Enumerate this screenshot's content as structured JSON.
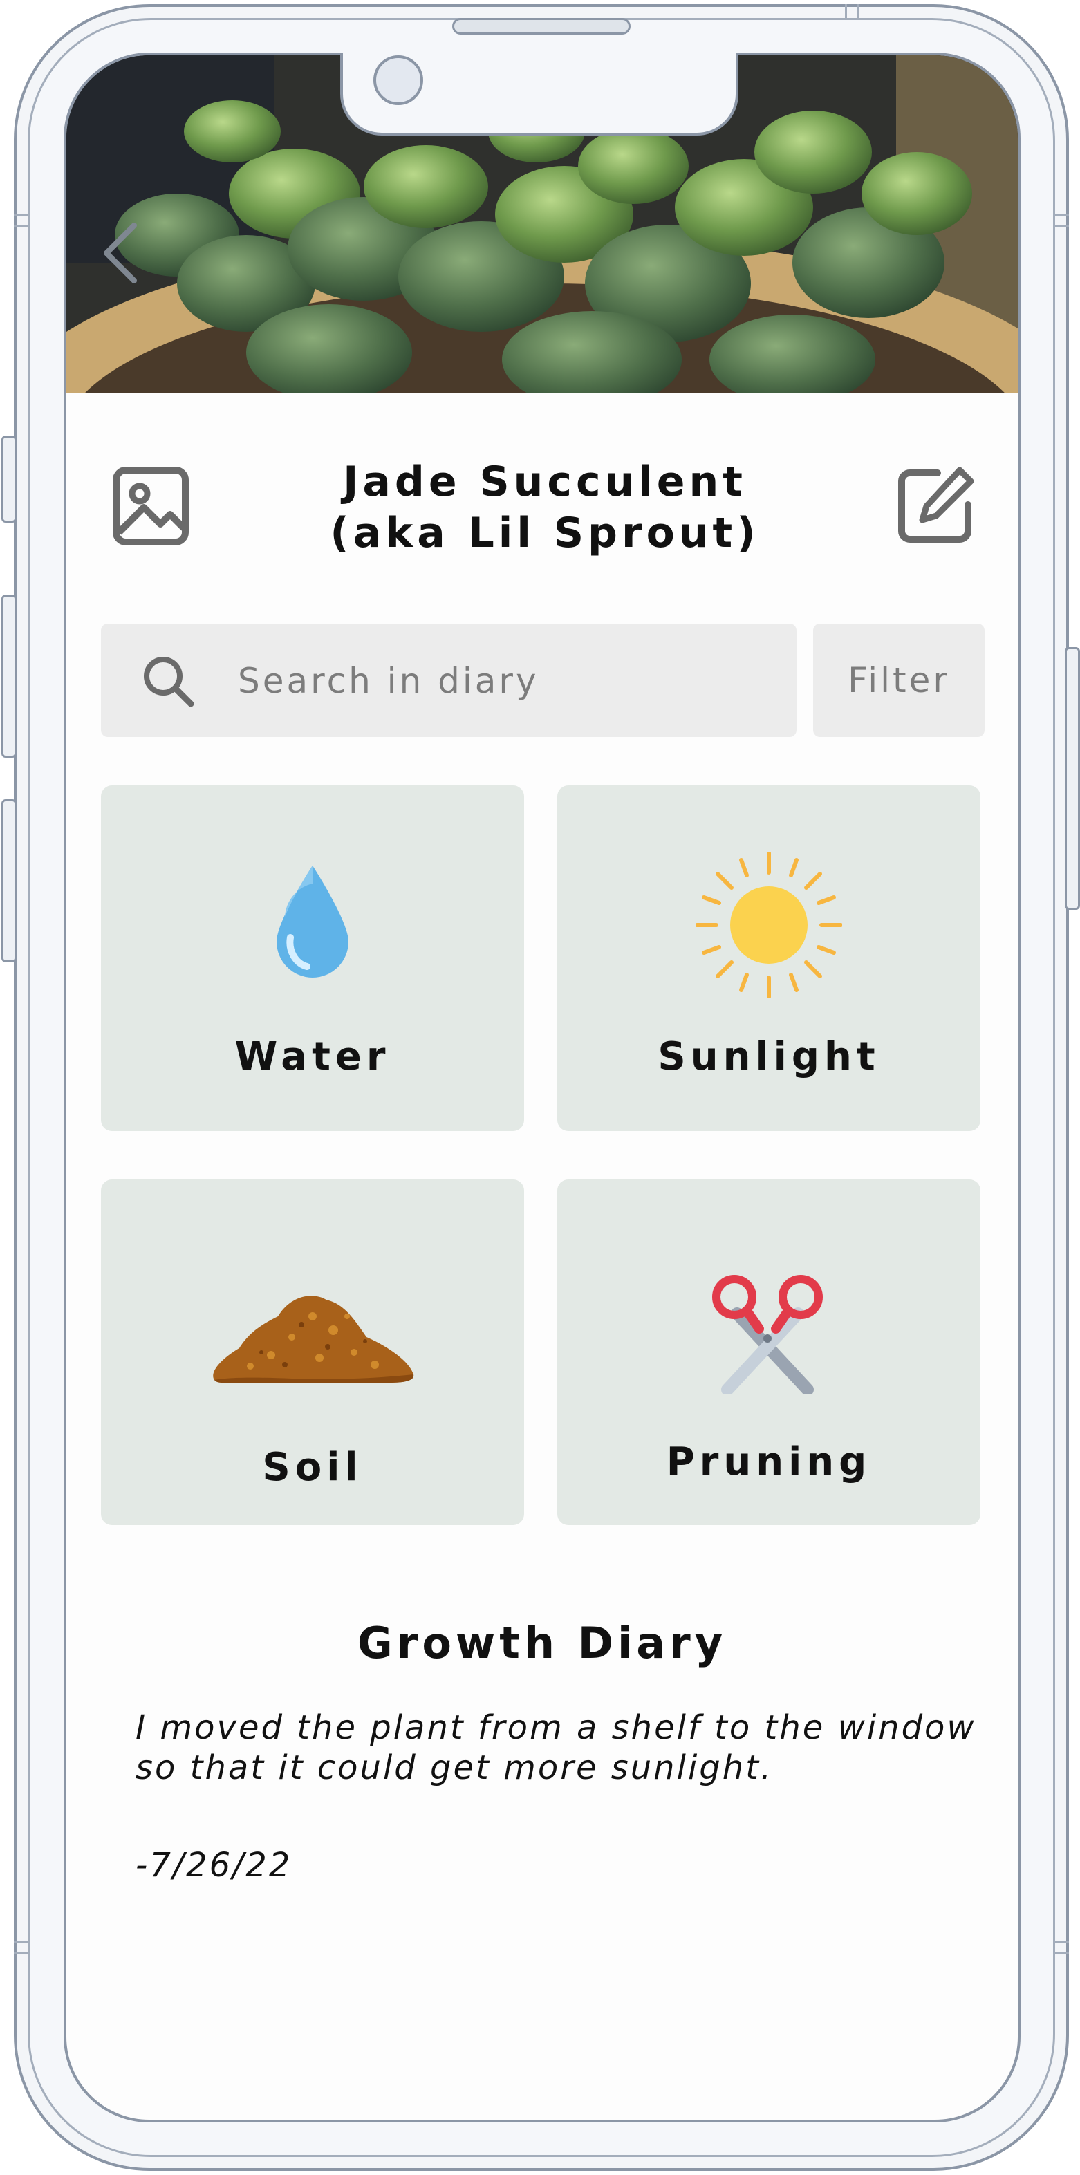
{
  "plant": {
    "title_line1": "Jade Succulent",
    "title_line2": "(aka Lil Sprout)"
  },
  "search": {
    "placeholder": "Search in diary",
    "value": ""
  },
  "filter_label": "Filter",
  "care_tiles": [
    {
      "label": "Water",
      "icon": "water-drop-icon"
    },
    {
      "label": "Sunlight",
      "icon": "sun-icon"
    },
    {
      "label": "Soil",
      "icon": "soil-pile-icon"
    },
    {
      "label": "Pruning",
      "icon": "scissors-icon"
    }
  ],
  "diary": {
    "heading": "Growth Diary",
    "entry_text": "I moved the plant from a shelf to the window so that it could get more sunlight.",
    "entry_date": "-7/26/22"
  },
  "colors": {
    "tile_bg": "#e3e9e5",
    "search_bg": "#ececec",
    "frame": "#8b96a6",
    "water": "#5fb3e8",
    "sun": "#fbd24e",
    "soil": "#b26a1c",
    "scissors": "#e23b4a"
  },
  "icons": [
    "back-chevron-icon",
    "gallery-image-icon",
    "edit-pencil-icon",
    "search-icon"
  ]
}
